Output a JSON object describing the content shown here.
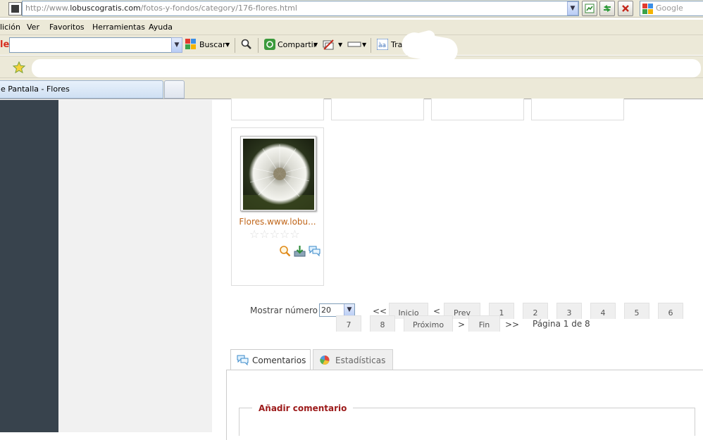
{
  "browser": {
    "url_prefix": "http://www.",
    "url_domain": "lobuscogratis.com",
    "url_path": "/fotos-y-fondos/category/176-flores.html",
    "search_placeholder": "Google",
    "menu": [
      "lición",
      "Ver",
      "Favoritos",
      "Herramientas",
      "Ayuda"
    ],
    "toolbar": {
      "buscar_label": "Buscar",
      "compartir_label": "Compartir",
      "traducir_label": "Tradu"
    },
    "tab_title": "e Pantalla - Flores"
  },
  "gallery": {
    "thumbnail_caption": "Flores.www.lobu...",
    "rating_stars": "☆☆☆☆☆",
    "rating_value": 0,
    "rating_max": 5
  },
  "pagination": {
    "mostrar_label": "Mostrar número",
    "per_page": "20",
    "first_arrow": "<<",
    "inicio": "Inicio",
    "prev_arrow": "<",
    "prev": "Prev",
    "pages": [
      "1",
      "2",
      "3",
      "4",
      "5",
      "6",
      "7",
      "8"
    ],
    "proximo": "Próximo",
    "next_arrow": ">",
    "fin": "Fin",
    "last_arrow": ">>",
    "page_status": "Página 1 de 8"
  },
  "tabs": {
    "comentarios": "Comentarios",
    "estadisticas": "Estadísticas"
  },
  "comment_form": {
    "legend": "Añadir comentario"
  },
  "colors": {
    "sidebar_dark": "#38434d",
    "caption_orange": "#c0661a",
    "legend_red": "#9c1a1a"
  }
}
